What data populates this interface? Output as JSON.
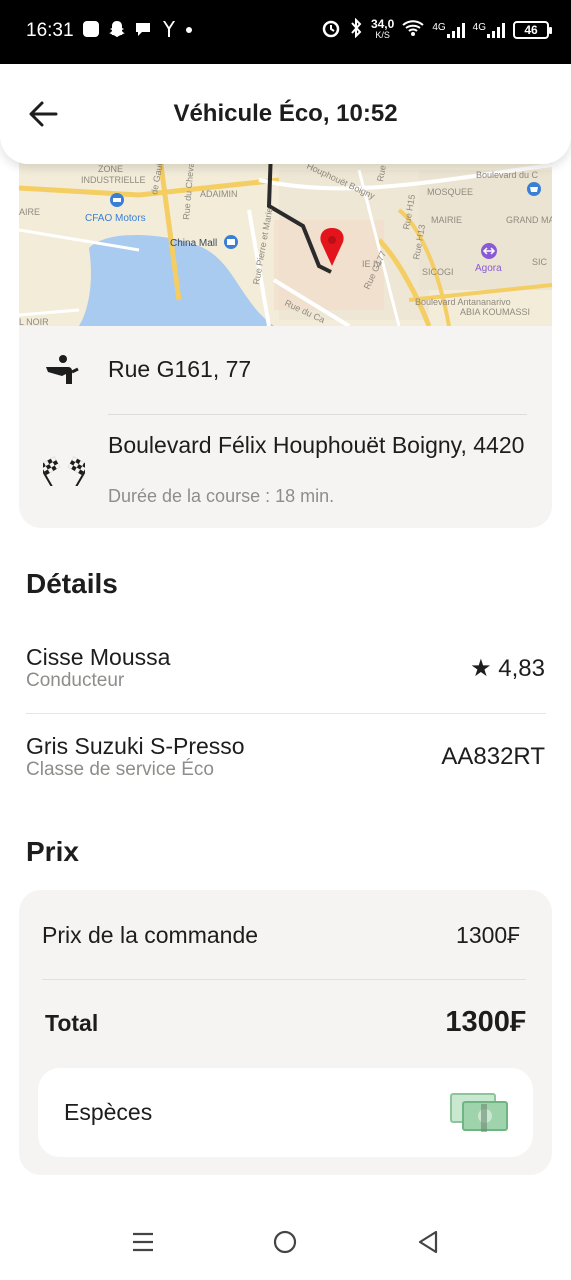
{
  "status_bar": {
    "time": "16:31",
    "network_speed_value": "34,0",
    "network_speed_unit": "K/S",
    "signal_1": "4G",
    "signal_2": "4G",
    "battery": "46"
  },
  "header": {
    "title": "Véhicule Éco, 10:52",
    "back_icon": "arrow-left-icon"
  },
  "map": {
    "labels": {
      "zone": "ZONE",
      "industrielle": "INDUSTRIELLE",
      "de_gaulle": "de Gaulle",
      "adaimin": "ADAIMIN",
      "chevalier": "Rue du Chevalier",
      "houphouet": "Houphouët Boigny",
      "h7": "Rue H7",
      "mosquee": "MOSQUEE",
      "boulevard_top": "Boulevard du C",
      "cfao": "CFAO Motors",
      "china_mall": "China Mall",
      "mairie": "MAIRIE",
      "grand_ma": "GRAND MA",
      "h13": "Rue H13",
      "h15": "Rue H15",
      "agora": "Agora",
      "sicogi": "SICOGI",
      "pierre_marie": "Rue Pierre et Marie",
      "g177": "Rue G177",
      "antananarivo": "Boulevard Antananarivo",
      "abia": "ABIA KOUMASSI",
      "rue_du_ca": "Rue du Ca",
      "aire": "AIRE",
      "noir": "L NOIR",
      "ie_iv": "IE IV",
      "sic": "SIC"
    }
  },
  "route": {
    "from": "Rue G161, 77",
    "to": "Boulevard Félix Houphouët Boigny, 4420",
    "duration": "Durée de la course : 18 min."
  },
  "details": {
    "title": "Détails",
    "driver_name": "Cisse Moussa",
    "driver_role": "Conducteur",
    "rating": "★ 4,83",
    "car": "Gris Suzuki S-Presso",
    "car_class": "Classe de service Éco",
    "plate": "AA832RT"
  },
  "price": {
    "title": "Prix",
    "order_label": "Prix de la commande",
    "order_value": "1300₣",
    "total_label": "Total",
    "total_value": "1300₣",
    "payment_method": "Espèces",
    "payment_icon": "cash-icon"
  },
  "navbar": {
    "menu_icon": "menu-icon",
    "home_icon": "home-circle-icon",
    "back_icon": "back-triangle-icon"
  },
  "colors": {
    "card_bg": "#f5f4f2",
    "secondary_text": "#8e8d8a",
    "route_line": "#2b2b2b",
    "pin": "#e3141b",
    "water": "#a9cbef",
    "map_road": "#f4cd63"
  }
}
